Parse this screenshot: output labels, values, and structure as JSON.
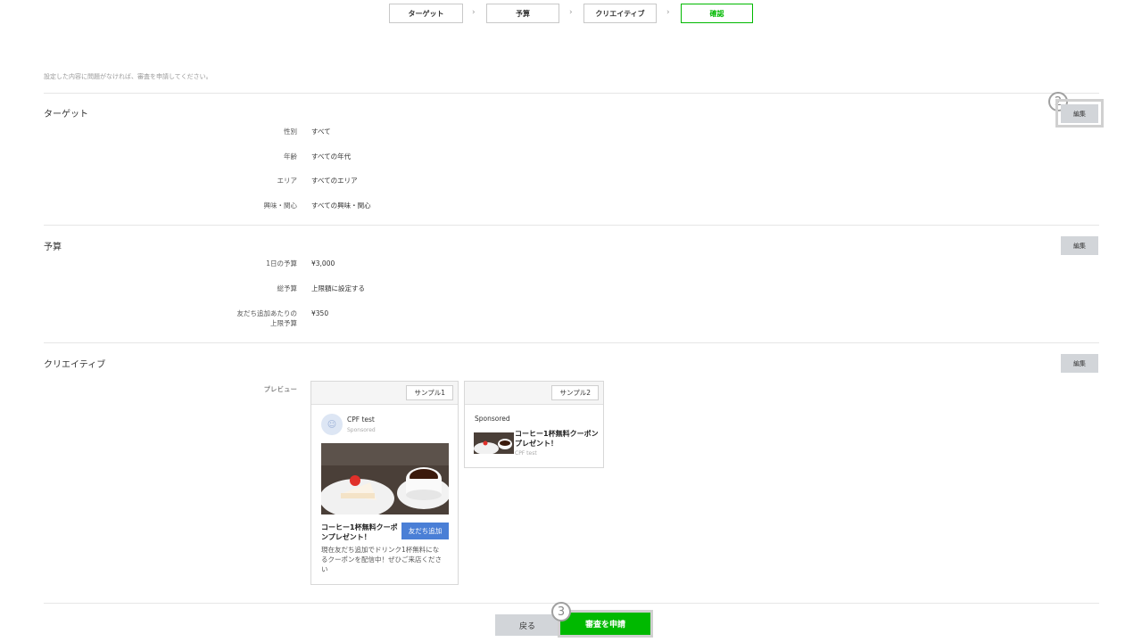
{
  "stepper": {
    "steps": [
      "ターゲット",
      "予算",
      "クリエイティブ",
      "確認"
    ],
    "separator": "›"
  },
  "intro_text": "設定した内容に問題がなければ、審査を申請してください。",
  "target": {
    "title": "ターゲット",
    "edit_label": "編集",
    "rows": [
      {
        "label": "性別",
        "value": "すべて"
      },
      {
        "label": "年齢",
        "value": "すべての年代"
      },
      {
        "label": "エリア",
        "value": "すべてのエリア"
      },
      {
        "label": "興味・関心",
        "value": "すべての興味・関心"
      }
    ]
  },
  "budget": {
    "title": "予算",
    "edit_label": "編集",
    "rows": [
      {
        "label": "1日の予算",
        "value": "¥3,000"
      },
      {
        "label": "総予算",
        "value": "上限額に設定する"
      },
      {
        "label": "友だち追加あたりの",
        "label2": "上限予算",
        "value": "¥350"
      }
    ]
  },
  "creative": {
    "title": "クリエイティブ",
    "edit_label": "編集",
    "preview_label": "プレビュー",
    "sample1": {
      "button": "サンプル1",
      "account_name": "CPF test",
      "account_sub": "Sponsored",
      "ad_title_1": "コーヒー1杯無料クーポ",
      "ad_title_2": "ンプレゼント！",
      "add_friend": "友だち追加",
      "desc_1": "現在友だち追加でドリンク1杯無料にな",
      "desc_2": "るクーポンを配信中！ぜひご来店くださ",
      "desc_3": "い"
    },
    "sample2": {
      "button": "サンプル2",
      "sponsored": "Sponsored",
      "ad_title_1": "コーヒー1杯無料クーポン",
      "ad_title_2": "プレゼント！",
      "account_name": "CPF test"
    }
  },
  "annotations": {
    "num2": "2",
    "num3": "3"
  },
  "footer": {
    "back_label": "戻る",
    "submit_label": "審査を申請"
  },
  "colors": {
    "accent": "#00b900",
    "add_friend": "#4a7fd6",
    "edit_bg": "#d2d5d9"
  }
}
